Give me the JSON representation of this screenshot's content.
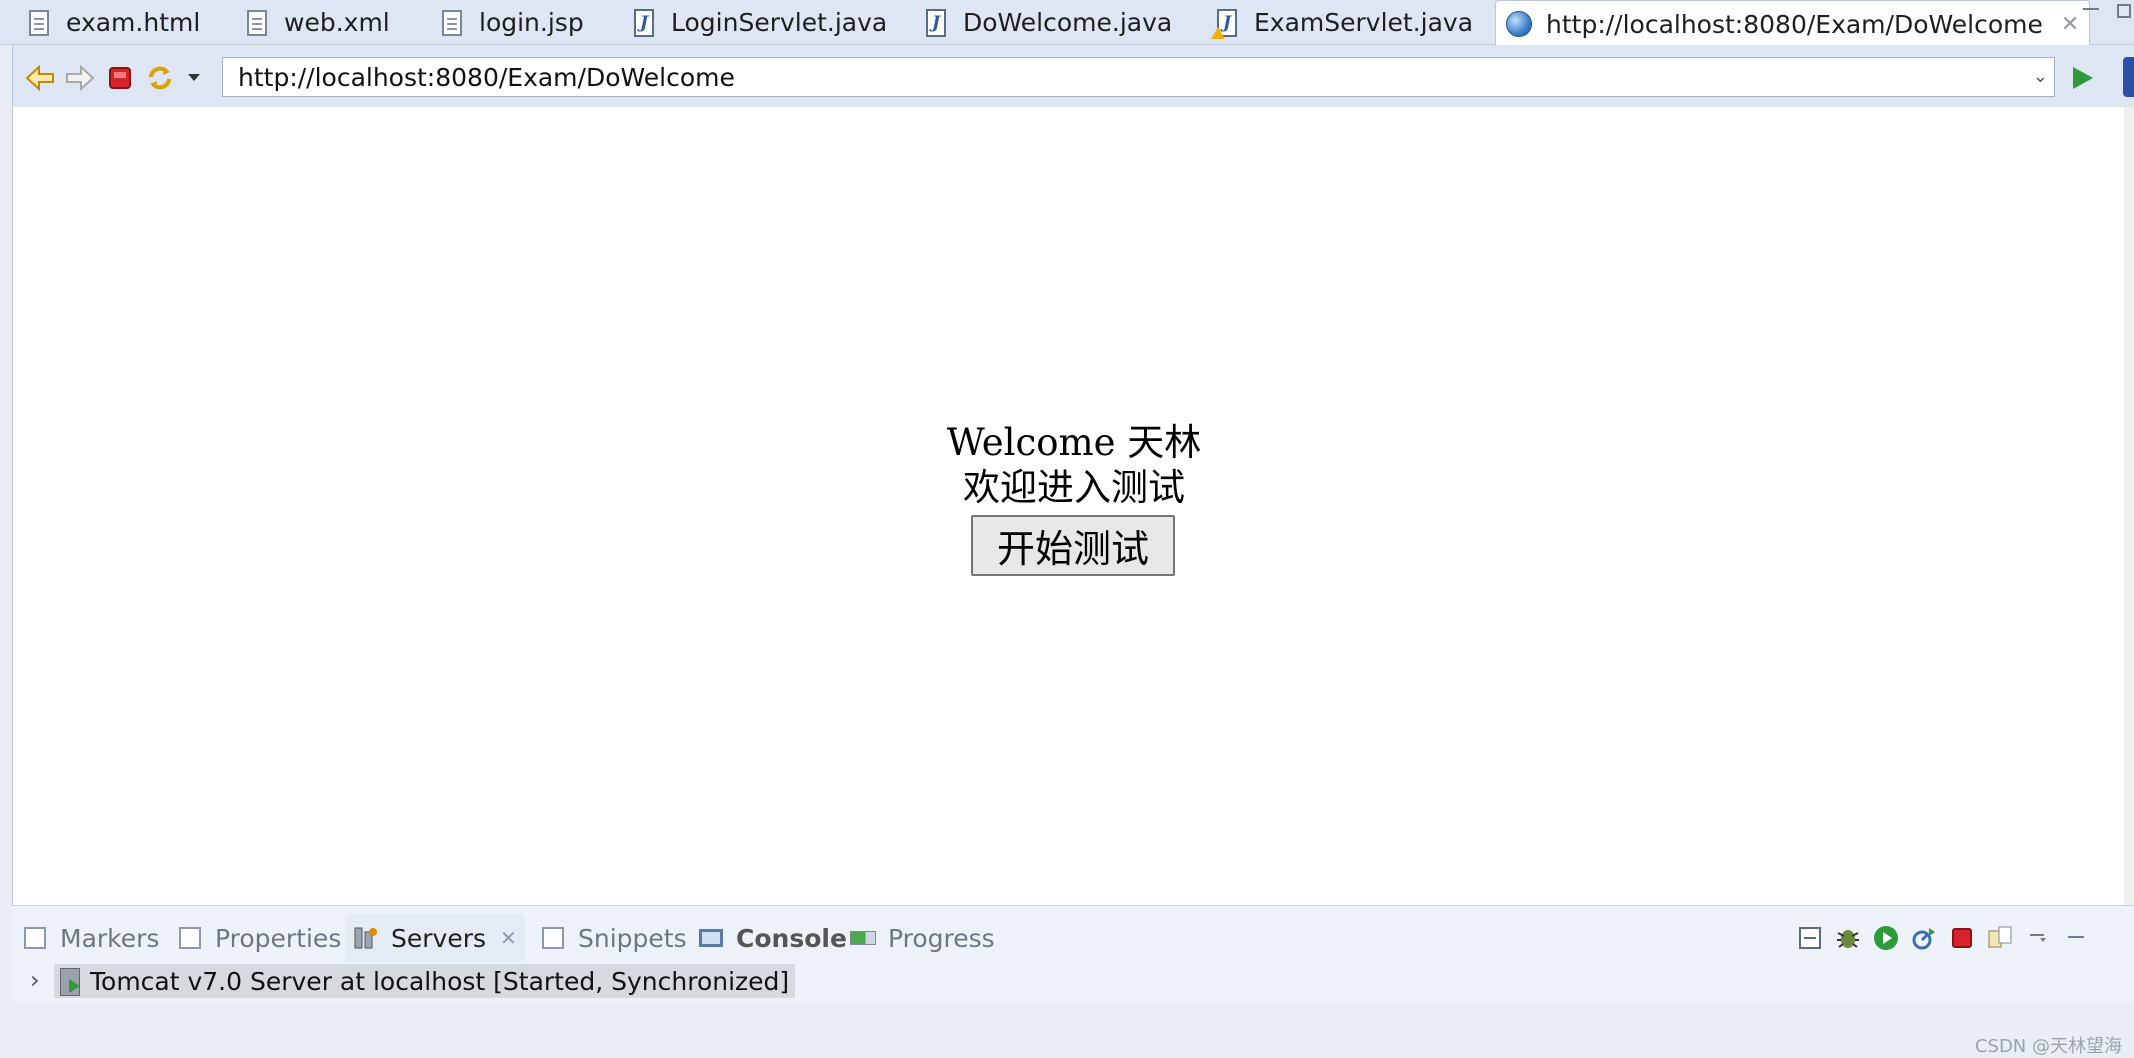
{
  "editor_tabs": [
    {
      "label": "exam.html",
      "icon": "html-file-icon"
    },
    {
      "label": "web.xml",
      "icon": "xml-file-icon"
    },
    {
      "label": "login.jsp",
      "icon": "jsp-file-icon"
    },
    {
      "label": "LoginServlet.java",
      "icon": "java-file-icon"
    },
    {
      "label": "DoWelcome.java",
      "icon": "java-file-icon"
    },
    {
      "label": "ExamServlet.java",
      "icon": "java-file-warning-icon"
    },
    {
      "label": "http://localhost:8080/Exam/DoWelcome",
      "icon": "globe-icon",
      "active": true
    }
  ],
  "browser": {
    "url": "http://localhost:8080/Exam/DoWelcome"
  },
  "page": {
    "welcome": "Welcome 天林",
    "subtitle": "欢迎进入测试",
    "start_button": "开始测试"
  },
  "bottom_panel": {
    "tabs": [
      {
        "label": "Markers",
        "icon": "markers-icon"
      },
      {
        "label": "Properties",
        "icon": "properties-icon"
      },
      {
        "label": "Servers",
        "icon": "servers-icon",
        "active": true
      },
      {
        "label": "Snippets",
        "icon": "snippets-icon"
      },
      {
        "label": "Console",
        "icon": "console-icon"
      },
      {
        "label": "Progress",
        "icon": "progress-icon"
      }
    ],
    "server_entry": "Tomcat v7.0 Server at localhost  [Started, Synchronized]"
  },
  "watermark": "CSDN @天林望海",
  "colors": {
    "go": "#2e9a3a",
    "stop": "#d8232a",
    "accent": "#2a4fa8"
  }
}
